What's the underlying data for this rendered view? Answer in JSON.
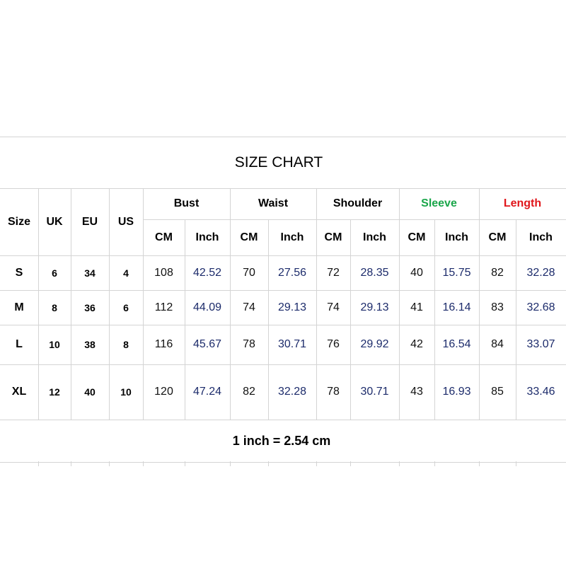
{
  "title": "SIZE CHART",
  "footer": "1 inch = 2.54 cm",
  "colors": {
    "sleeve_header": "#1aa64a",
    "length_header": "#e0161b",
    "inch_value": "#1c2b6b",
    "grid_line": "#d4d4d4"
  },
  "headers": {
    "size": "Size",
    "uk": "UK",
    "eu": "EU",
    "us": "US",
    "groups": [
      "Bust",
      "Waist",
      "Shoulder",
      "Sleeve",
      "Length"
    ],
    "cm": "CM",
    "inch": "Inch"
  },
  "rows": [
    {
      "size": "S",
      "uk": "6",
      "eu": "34",
      "us": "4",
      "values": [
        [
          "108",
          "42.52"
        ],
        [
          "70",
          "27.56"
        ],
        [
          "72",
          "28.35"
        ],
        [
          "40",
          "15.75"
        ],
        [
          "82",
          "32.28"
        ]
      ]
    },
    {
      "size": "M",
      "uk": "8",
      "eu": "36",
      "us": "6",
      "values": [
        [
          "112",
          "44.09"
        ],
        [
          "74",
          "29.13"
        ],
        [
          "74",
          "29.13"
        ],
        [
          "41",
          "16.14"
        ],
        [
          "83",
          "32.68"
        ]
      ]
    },
    {
      "size": "L",
      "uk": "10",
      "eu": "38",
      "us": "8",
      "values": [
        [
          "116",
          "45.67"
        ],
        [
          "78",
          "30.71"
        ],
        [
          "76",
          "29.92"
        ],
        [
          "42",
          "16.54"
        ],
        [
          "84",
          "33.07"
        ]
      ]
    },
    {
      "size": "XL",
      "uk": "12",
      "eu": "40",
      "us": "10",
      "values": [
        [
          "120",
          "47.24"
        ],
        [
          "82",
          "32.28"
        ],
        [
          "78",
          "30.71"
        ],
        [
          "43",
          "16.93"
        ],
        [
          "85",
          "33.46"
        ]
      ]
    }
  ]
}
